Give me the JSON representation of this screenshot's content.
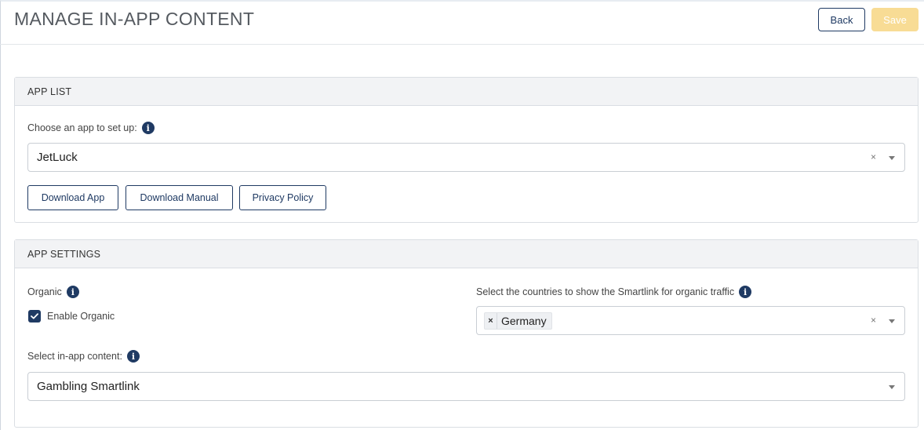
{
  "header": {
    "title": "MANAGE IN-APP CONTENT",
    "back_label": "Back",
    "save_label": "Save"
  },
  "colors": {
    "primary": "#1f3a63",
    "save_disabled": "#f8dc95",
    "panel_header_bg": "#f2f3f5"
  },
  "app_list": {
    "heading": "APP LIST",
    "choose_label": "Choose an app to set up:",
    "selected_app": "JetLuck",
    "clear_symbol": "×",
    "buttons": {
      "download_app": "Download App",
      "download_manual": "Download Manual",
      "privacy_policy": "Privacy Policy"
    }
  },
  "app_settings": {
    "heading": "APP SETTINGS",
    "organic_label": "Organic",
    "enable_organic_label": "Enable Organic",
    "enable_organic_checked": true,
    "countries_label": "Select the countries to show the Smartlink for organic traffic",
    "countries_selected": [
      "Germany"
    ],
    "tag_remove_symbol": "×",
    "clear_symbol": "×",
    "content_label": "Select in-app content:",
    "content_selected": "Gambling Smartlink"
  },
  "icons": {
    "info": "i",
    "info_icon_name": "info-icon",
    "check_icon_name": "checkmark-icon",
    "caret_icon_name": "chevron-down-icon"
  }
}
